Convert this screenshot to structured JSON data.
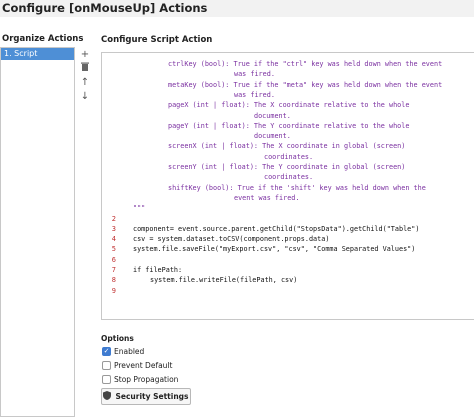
{
  "window": {
    "title": "Configure [onMouseUp] Actions"
  },
  "left_panel": {
    "header": "Organize Actions",
    "items": [
      {
        "label": "1. Script",
        "selected": true
      }
    ],
    "tools": [
      {
        "name": "add-icon",
        "glyph": "+"
      },
      {
        "name": "delete-icon",
        "glyph": "🗑"
      },
      {
        "name": "move-up-icon",
        "glyph": "↑"
      },
      {
        "name": "move-down-icon",
        "glyph": "↓"
      }
    ]
  },
  "script": {
    "header": "Configure Script Action",
    "lines": [
      {
        "num": "",
        "text": "ctrlKey (bool): True if the \"ctrl\" key was held down when the event",
        "style": "doc",
        "indent": 66
      },
      {
        "num": "",
        "text": "was fired.",
        "style": "doc",
        "indent": 132
      },
      {
        "num": "",
        "text": "metaKey (bool): True if the \"meta\" key was held down when the event",
        "style": "doc",
        "indent": 66
      },
      {
        "num": "",
        "text": "was fired.",
        "style": "doc",
        "indent": 132
      },
      {
        "num": "",
        "text": "pageX (int | float): The X coordinate relative to the whole",
        "style": "doc",
        "indent": 66
      },
      {
        "num": "",
        "text": "document.",
        "style": "doc",
        "indent": 152
      },
      {
        "num": "",
        "text": "pageY (int | float): The Y coordinate relative to the whole",
        "style": "doc",
        "indent": 66
      },
      {
        "num": "",
        "text": "document.",
        "style": "doc",
        "indent": 152
      },
      {
        "num": "",
        "text": "screenX (int | float): The X coordinate in global (screen)",
        "style": "doc",
        "indent": 66
      },
      {
        "num": "",
        "text": "coordinates.",
        "style": "doc",
        "indent": 162
      },
      {
        "num": "",
        "text": "screenY (int | float): The Y coordinate in global (screen)",
        "style": "doc",
        "indent": 66
      },
      {
        "num": "",
        "text": "coordinates.",
        "style": "doc",
        "indent": 162
      },
      {
        "num": "",
        "text": "shiftKey (bool): True if the 'shift' key was held down when the",
        "style": "doc",
        "indent": 66
      },
      {
        "num": "",
        "text": "event was fired.",
        "style": "doc",
        "indent": 132
      },
      {
        "num": "",
        "text": "\"\"\"",
        "style": "doc",
        "indent": 31
      },
      {
        "num": "2",
        "text": "",
        "style": "plain",
        "indent": 31
      },
      {
        "num": "3",
        "text": "component= event.source.parent.getChild(\"StopsData\").getChild(\"Table\")",
        "style": "plain",
        "indent": 31
      },
      {
        "num": "4",
        "text": "csv = system.dataset.toCSV(component.props.data)",
        "style": "plain",
        "indent": 31
      },
      {
        "num": "5",
        "text": "system.file.saveFile(\"myExport.csv\", \"csv\", \"Comma Separated Values\")",
        "style": "plain",
        "indent": 31
      },
      {
        "num": "6",
        "text": "",
        "style": "plain",
        "indent": 31
      },
      {
        "num": "7",
        "text": "if filePath:",
        "style": "plain",
        "indent": 31
      },
      {
        "num": "8",
        "text": "system.file.writeFile(filePath, csv)",
        "style": "plain",
        "indent": 48
      },
      {
        "num": "9",
        "text": "",
        "style": "plain",
        "indent": 31
      }
    ]
  },
  "options": {
    "header": "Options",
    "items": [
      {
        "label": "Enabled",
        "checked": true
      },
      {
        "label": "Prevent Default",
        "checked": false
      },
      {
        "label": "Stop Propagation",
        "checked": false
      }
    ],
    "security_button": "Security Settings"
  }
}
